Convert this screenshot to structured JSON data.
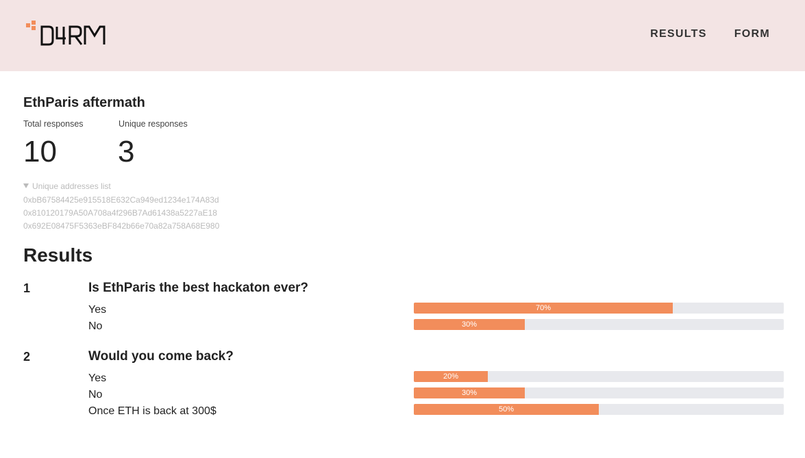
{
  "header": {
    "logo_text": "D4RM",
    "colors": {
      "background": "#f3e4e4",
      "accent": "#f28d5b",
      "logo_ink": "#111111"
    },
    "nav": [
      {
        "label": "RESULTS"
      },
      {
        "label": "FORM"
      }
    ]
  },
  "survey": {
    "title": "EthParis aftermath",
    "total_label": "Total responses",
    "total_value": "10",
    "unique_label": "Unique responses",
    "unique_value": "3",
    "addresses_toggle": "Unique addresses list",
    "addresses": [
      "0xbB67584425e915518E632Ca949ed1234e174A83d",
      "0x810120179A50A708a4f296B7Ad61438a5227aE18",
      "0x692E08475F5363eBF842b66e70a82a758A68E980"
    ]
  },
  "results": {
    "heading": "Results",
    "bar_colors": {
      "fill": "#f28d5b",
      "track": "#e8e9ed"
    },
    "questions": [
      {
        "number": "1",
        "text": "Is EthParis the best hackaton ever?",
        "options": [
          {
            "label": "Yes",
            "percent": 70,
            "percent_label": "70%"
          },
          {
            "label": "No",
            "percent": 30,
            "percent_label": "30%"
          }
        ]
      },
      {
        "number": "2",
        "text": "Would you come back?",
        "options": [
          {
            "label": "Yes",
            "percent": 20,
            "percent_label": "20%"
          },
          {
            "label": "No",
            "percent": 30,
            "percent_label": "30%"
          },
          {
            "label": "Once ETH is back at 300$",
            "percent": 50,
            "percent_label": "50%"
          }
        ]
      }
    ]
  }
}
